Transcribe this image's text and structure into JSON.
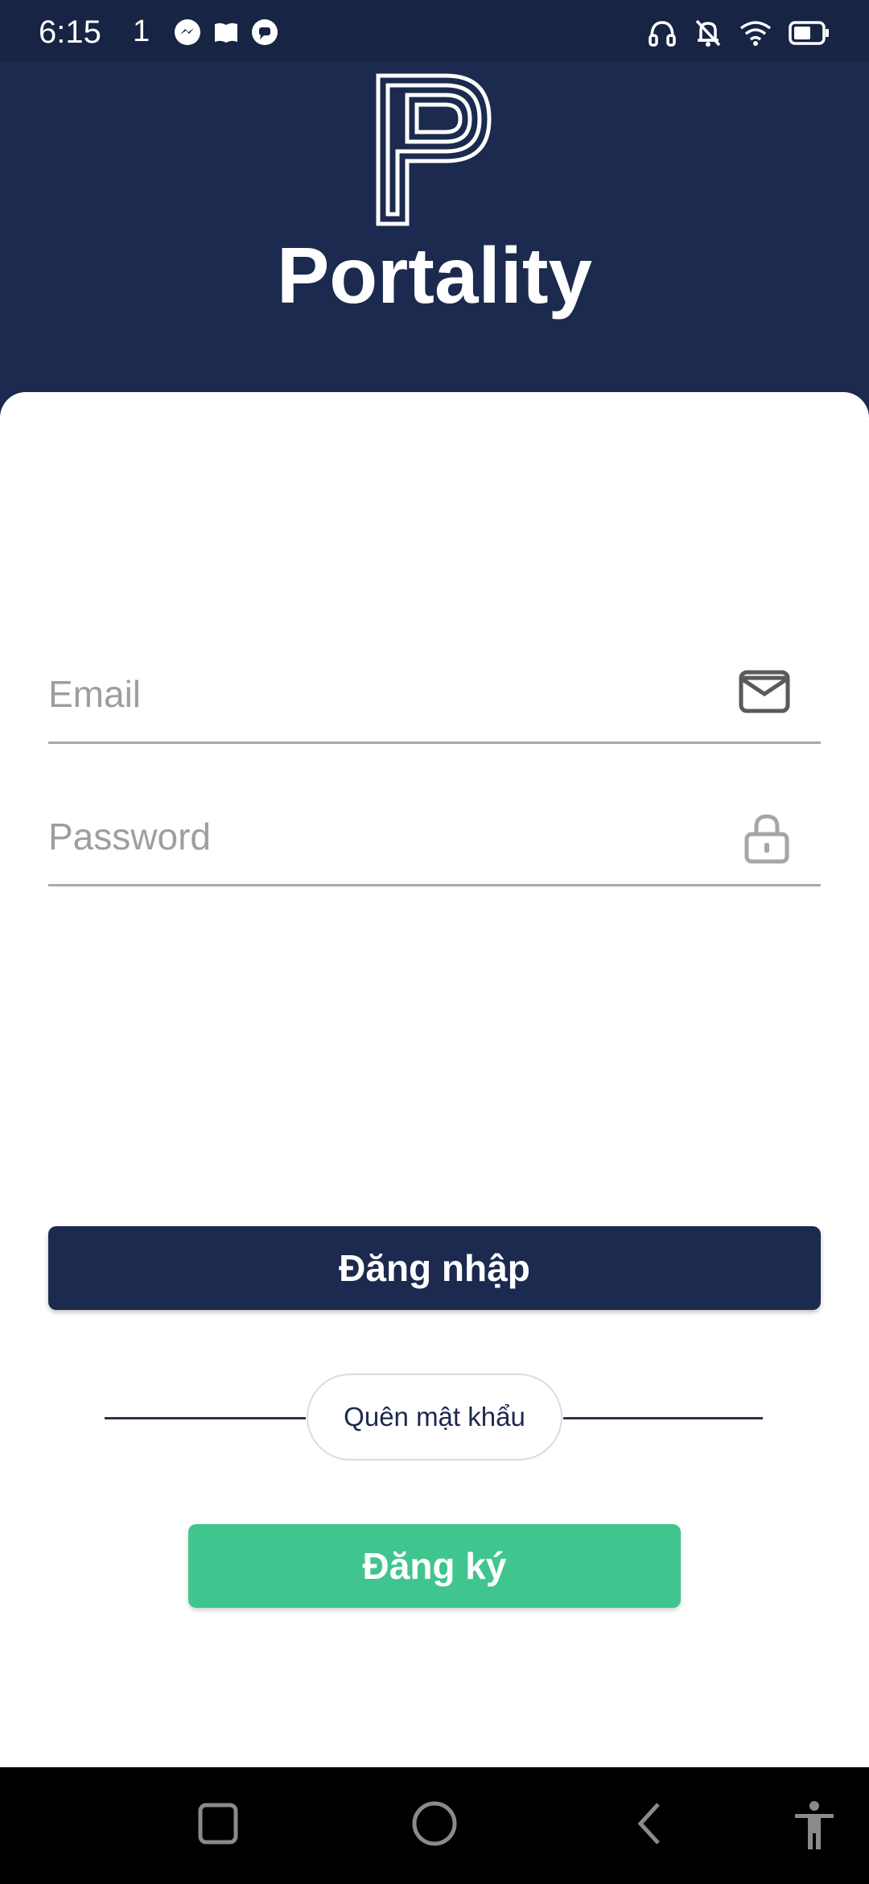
{
  "status_bar": {
    "time": "6:15",
    "signal_indicator": "1",
    "left_icons": [
      "messenger-icon",
      "book-icon",
      "chat-bubble-icon"
    ],
    "right_icons": [
      "headphones-icon",
      "bell-off-icon",
      "wifi-icon",
      "battery-icon"
    ]
  },
  "app": {
    "name": "Portality",
    "logo_icon": "portality-p-logo"
  },
  "login_form": {
    "email": {
      "placeholder": "Email",
      "value": "",
      "icon": "mail-icon"
    },
    "password": {
      "placeholder": "Password",
      "value": "",
      "icon": "lock-icon"
    },
    "login_label": "Đăng nhập",
    "forgot_label": "Quên mật khẩu",
    "register_label": "Đăng ký"
  },
  "colors": {
    "primary": "#1b2a4e",
    "accent_green": "#41c58f",
    "background": "#ffffff"
  },
  "nav_bar": {
    "items": [
      "recents-square-icon",
      "home-circle-icon",
      "back-chevron-icon",
      "accessibility-icon"
    ]
  }
}
